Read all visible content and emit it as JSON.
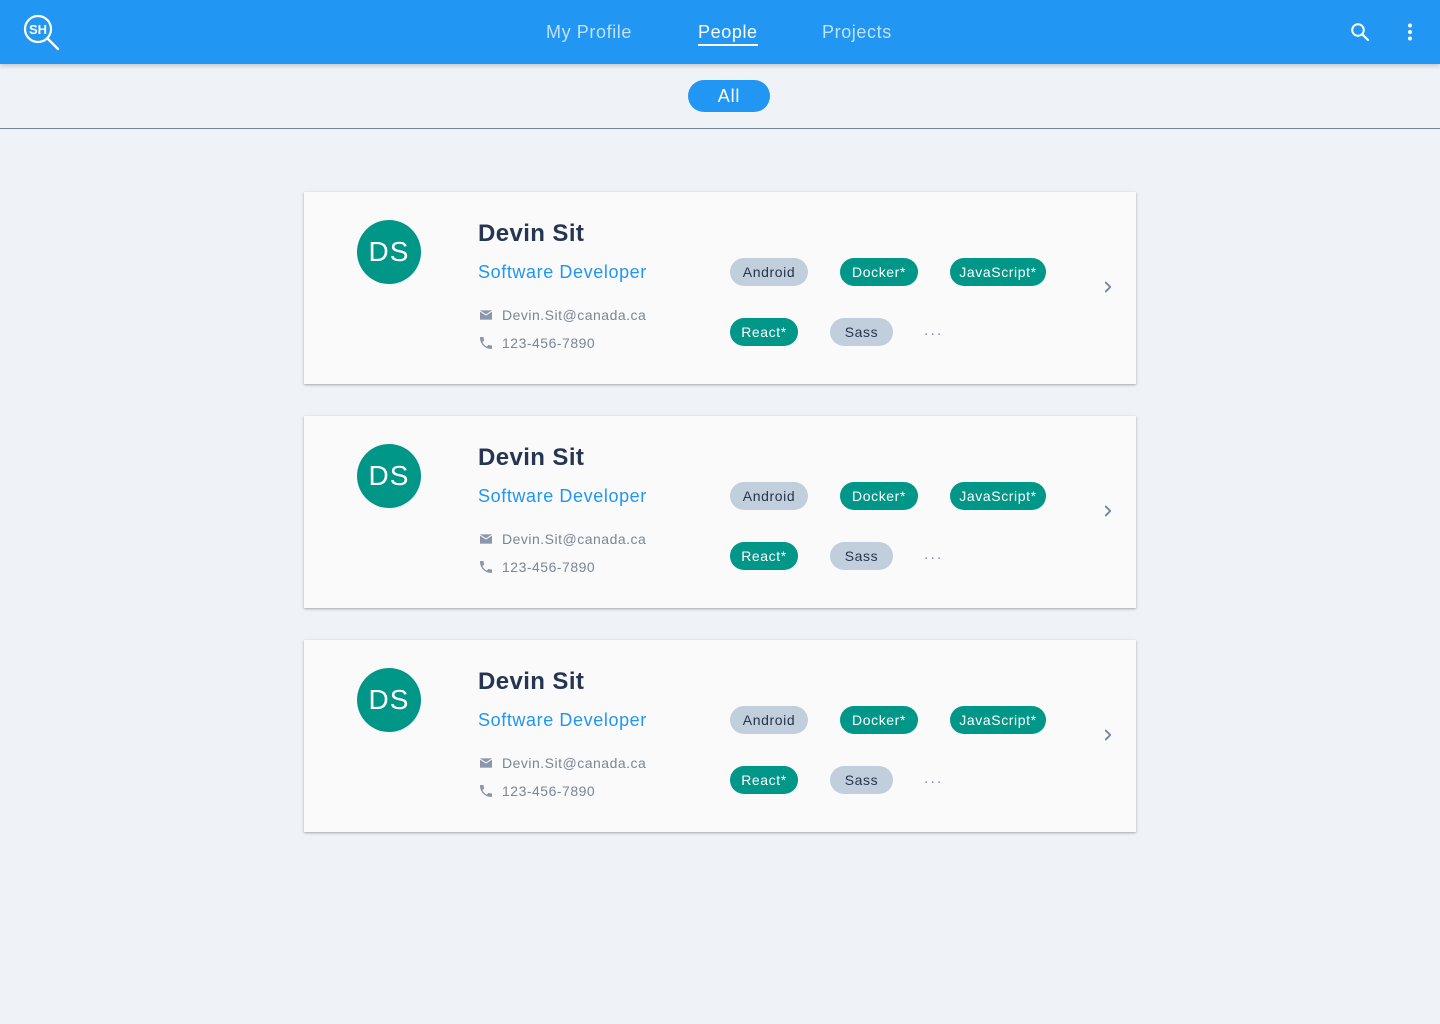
{
  "header": {
    "logo_text": "SH",
    "tabs": [
      {
        "label": "My Profile"
      },
      {
        "label": "People"
      },
      {
        "label": "Projects"
      }
    ],
    "active_tab": "People",
    "icons": [
      "search-icon",
      "more-vert-icon"
    ]
  },
  "filter": {
    "all_label": "All"
  },
  "colors": {
    "primary": "#2196f3",
    "avatar": "#009688",
    "skill_highlight": "#009688",
    "skill_default": "#c1cedb",
    "name": "#263550"
  },
  "people": [
    {
      "initials": "DS",
      "name": "Devin Sit",
      "role": "Software Developer",
      "email": "Devin.Sit@canada.ca",
      "phone": "123-456-7890",
      "skills": [
        {
          "label": "Android",
          "highlight": false
        },
        {
          "label": "Docker*",
          "highlight": true
        },
        {
          "label": "JavaScript*",
          "highlight": true
        },
        {
          "label": "React*",
          "highlight": true
        },
        {
          "label": "Sass",
          "highlight": false
        }
      ],
      "more": "..."
    },
    {
      "initials": "DS",
      "name": "Devin Sit",
      "role": "Software Developer",
      "email": "Devin.Sit@canada.ca",
      "phone": "123-456-7890",
      "skills": [
        {
          "label": "Android",
          "highlight": false
        },
        {
          "label": "Docker*",
          "highlight": true
        },
        {
          "label": "JavaScript*",
          "highlight": true
        },
        {
          "label": "React*",
          "highlight": true
        },
        {
          "label": "Sass",
          "highlight": false
        }
      ],
      "more": "..."
    },
    {
      "initials": "DS",
      "name": "Devin Sit",
      "role": "Software Developer",
      "email": "Devin.Sit@canada.ca",
      "phone": "123-456-7890",
      "skills": [
        {
          "label": "Android",
          "highlight": false
        },
        {
          "label": "Docker*",
          "highlight": true
        },
        {
          "label": "JavaScript*",
          "highlight": true
        },
        {
          "label": "React*",
          "highlight": true
        },
        {
          "label": "Sass",
          "highlight": false
        }
      ],
      "more": "..."
    }
  ]
}
